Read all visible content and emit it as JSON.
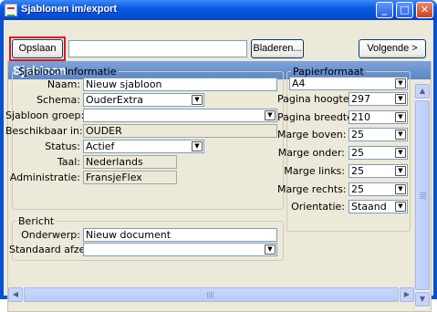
{
  "window": {
    "title": "Sjablonen im/export",
    "controls": {
      "minimize": "_",
      "maximize": "□",
      "close": "✕"
    }
  },
  "toolbar": {
    "save_in_label": "Opslaan in:",
    "path_value": "",
    "browse_label": "Bladeren...",
    "next_label": "Volgende >"
  },
  "panel": {
    "header": "Sjabloon"
  },
  "info": {
    "legend": "Sjabloon Informatie",
    "name_label": "Naam:",
    "name_value": "Nieuw sjabloon",
    "schema_label": "Schema:",
    "schema_value": "OuderExtra",
    "group_label": "Sjabloon groep:",
    "group_value": "",
    "available_label": "Beschikbaar in:",
    "available_value": "OUDER",
    "status_label": "Status:",
    "status_value": "Actief",
    "language_label": "Taal:",
    "language_value": "Nederlands",
    "administration_label": "Administratie:",
    "administration_value": "FransjeFlex"
  },
  "paper": {
    "legend": "Papierformaat",
    "format_value": "A4",
    "height_label": "Pagina hoogte:",
    "height_value": "297",
    "width_label": "Pagina breedte:",
    "width_value": "210",
    "margin_top_label": "Marge boven:",
    "margin_top_value": "25",
    "margin_bottom_label": "Marge onder:",
    "margin_bottom_value": "25",
    "margin_left_label": "Marge links:",
    "margin_left_value": "25",
    "margin_right_label": "Marge rechts:",
    "margin_right_value": "25",
    "orientation_label": "Orientatie:",
    "orientation_value": "Staand"
  },
  "message": {
    "legend": "Bericht",
    "subject_label": "Onderwerp:",
    "subject_value": "Nieuw document",
    "sender_label": "Standaard afzender:",
    "sender_value": ""
  },
  "icons": {
    "dropdown": "▼",
    "scroll_up": "▲",
    "scroll_down": "▼",
    "scroll_left": "◀",
    "scroll_right": "▶"
  }
}
